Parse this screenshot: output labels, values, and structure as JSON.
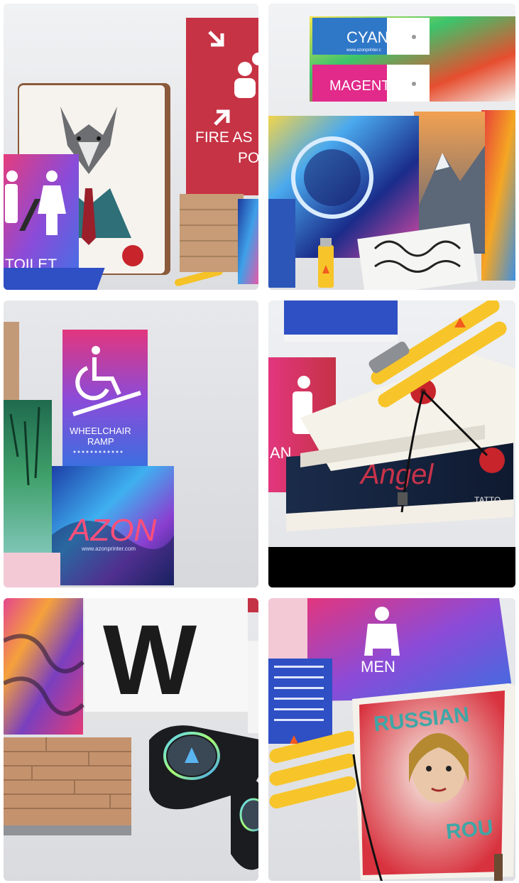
{
  "tiles": [
    {
      "id": "tile-1",
      "labels": {
        "fire_line1": "FIRE AS",
        "fire_line2": "PO",
        "toilet": "TOILET"
      }
    },
    {
      "id": "tile-2",
      "labels": {
        "cyan": "CYAN",
        "magenta": "MAGENTA",
        "swatch_url": "www.azonprinter.c"
      }
    },
    {
      "id": "tile-3",
      "labels": {
        "wheelchair_line1": "WHEELCHAIR",
        "wheelchair_line2": "RAMP",
        "brand": "AZON",
        "url": "www.azonprinter.com"
      }
    },
    {
      "id": "tile-4",
      "labels": {
        "sign_fragment": "AN",
        "notebook_word": "Angel",
        "tattoo": "TATTO"
      }
    },
    {
      "id": "tile-5",
      "labels": {
        "big_letter": "W"
      }
    },
    {
      "id": "tile-6",
      "labels": {
        "men": "MEN",
        "russian": "RUSSIAN",
        "roulette": "ROU"
      }
    }
  ],
  "colors": {
    "tile_bg": "#e6e7ea",
    "brand_orange": "#f25a1f",
    "sign_red": "#c53245",
    "pen_yellow": "#f7c52a",
    "cyan": "#2f78c8",
    "magenta": "#e12a8a"
  }
}
